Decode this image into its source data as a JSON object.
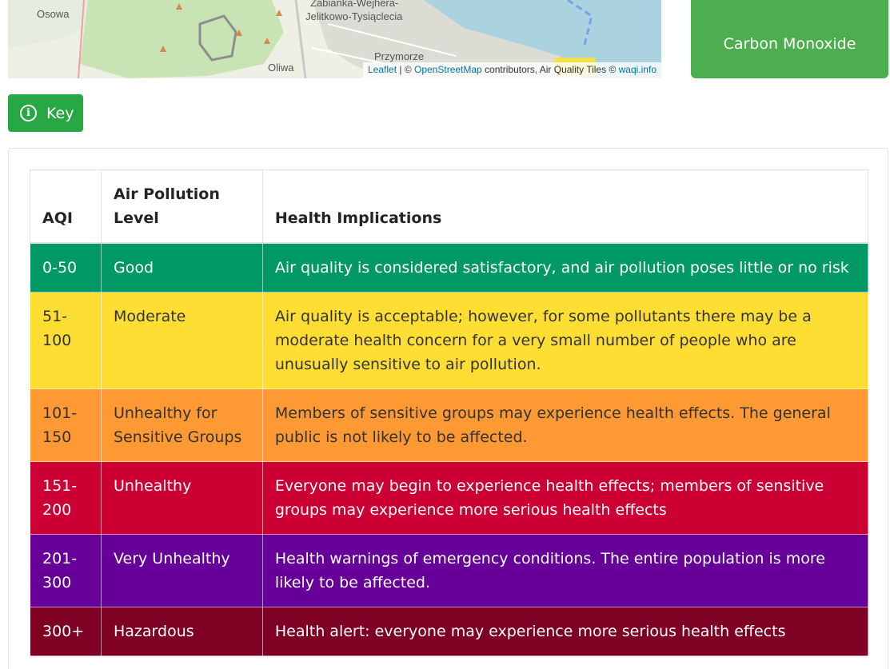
{
  "map": {
    "places": [
      "Osowa",
      "Żabianka-Wejhera-",
      "Jelitkowo-Tysiąclecia",
      "Przymorze",
      "Oliwa"
    ],
    "attribution": {
      "leaflet": "Leaflet",
      "sep1": " | © ",
      "osm": "OpenStreetMap",
      "mid": " contributors, Air Quality Tiles © ",
      "waqi": "waqi.info"
    }
  },
  "pollutant_button": {
    "label": "Carbon Monoxide"
  },
  "key_button": {
    "label": "Key",
    "icon": "info-circle-icon"
  },
  "aqi_table": {
    "headers": [
      "AQI",
      "Air Pollution Level",
      "Health Implications"
    ],
    "rows": [
      {
        "aqi": "0-50",
        "level": "Good",
        "implications": "Air quality is considered satisfactory, and air pollution poses little or no risk",
        "bg": "#009966",
        "fg": "#ffffff"
      },
      {
        "aqi": "51-100",
        "level": "Moderate",
        "implications": "Air quality is acceptable; however, for some pollutants there may be a moderate health concern for a very small number of people who are unusually sensitive to air pollution.",
        "bg": "#ffde33",
        "fg": "#333333"
      },
      {
        "aqi": "101-150",
        "level": "Unhealthy for Sensitive Groups",
        "implications": "Members of sensitive groups may experience health effects. The general public is not likely to be affected.",
        "bg": "#ff9933",
        "fg": "#333333"
      },
      {
        "aqi": "151-200",
        "level": "Unhealthy",
        "implications": "Everyone may begin to experience health effects; members of sensitive groups may experience more serious health effects",
        "bg": "#cc0033",
        "fg": "#ffffff"
      },
      {
        "aqi": "201-300",
        "level": "Very Unhealthy",
        "implications": "Health warnings of emergency conditions. The entire population is more likely to be affected.",
        "bg": "#660099",
        "fg": "#ffffff"
      },
      {
        "aqi": "300+",
        "level": "Hazardous",
        "implications": "Health alert: everyone may experience more serious health effects",
        "bg": "#7e0023",
        "fg": "#ffffff"
      }
    ]
  },
  "colors": {
    "green_button": "#28a745",
    "pollutant_button": "#4cae4f"
  }
}
